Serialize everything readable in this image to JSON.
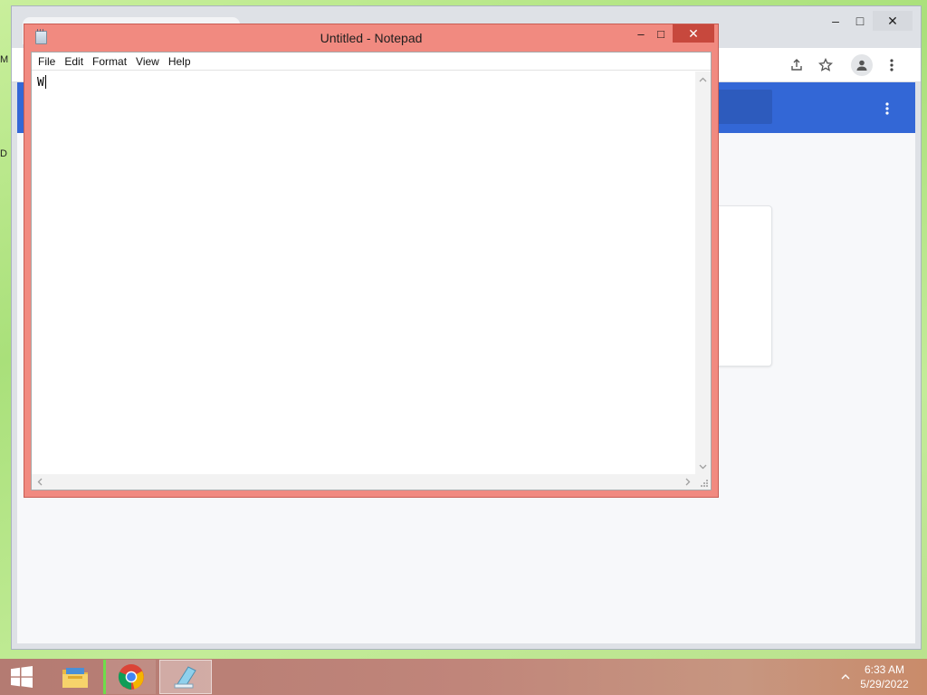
{
  "desktop": {
    "edge_glyphs": [
      "M",
      "D"
    ]
  },
  "chrome_window": {
    "window_buttons": {
      "minimize": "–",
      "maximize": "□",
      "close": "✕"
    },
    "toolbar_icons": [
      "share-icon",
      "star-icon",
      "account-icon",
      "more-menu-icon"
    ],
    "header_color": "#3367d6"
  },
  "notepad": {
    "title": "Untitled - Notepad",
    "window_buttons": {
      "minimize": "–",
      "maximize": "□",
      "close": "✕"
    },
    "menu": [
      "File",
      "Edit",
      "Format",
      "View",
      "Help"
    ],
    "text_content": "W",
    "frame_color": "#f18a80",
    "close_color": "#c7483d"
  },
  "taskbar": {
    "apps": [
      "file-explorer-icon",
      "chrome-icon",
      "notepad-icon"
    ],
    "clock": {
      "time": "6:33 AM",
      "date": "5/29/2022"
    }
  }
}
